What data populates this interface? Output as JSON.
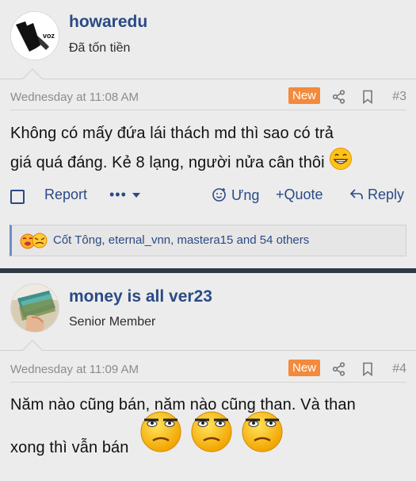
{
  "posts": [
    {
      "username": "howaredu",
      "user_title": "Đã tốn tiền",
      "date": "Wednesday at 11:08 AM",
      "badge": "New",
      "number": "#3",
      "content_line1": "Không có mấy đứa lái thách md thì sao có trả",
      "content_line2": "giá quá đáng. Kẻ 8 lạng, người nửa cân thôi",
      "actions": {
        "report": "Report",
        "more": "•••",
        "react": "Ưng",
        "quote": "+Quote",
        "reply": "Reply"
      },
      "reactions_text": "Cốt Tông, eternal_vnn, mastera15 and 54 others",
      "avatar_logo_text": "voz"
    },
    {
      "username": "money is all ver23",
      "user_title": "Senior Member",
      "date": "Wednesday at 11:09 AM",
      "badge": "New",
      "number": "#4",
      "content_line1": "Năm nào cũng bán, năm nào cũng than. Và than",
      "content_line2": "xong thì vẫn bán"
    }
  ],
  "colors": {
    "accent": "#2a4a86",
    "badge": "#f38a3c",
    "background": "#ececec",
    "divider": "#2f3a44"
  },
  "icons": [
    "share-icon",
    "bookmark-icon",
    "checkbox-icon",
    "chevron-down-icon",
    "react-face-icon",
    "reply-arrow-icon",
    "grin-emoji",
    "annoyed-emoji"
  ]
}
